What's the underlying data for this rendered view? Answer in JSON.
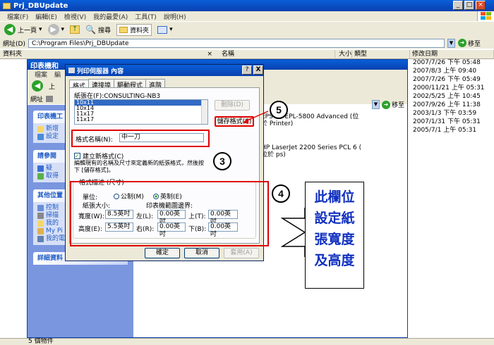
{
  "explorer": {
    "title": "Prj_DBUpdate",
    "menu": [
      "檔案(F)",
      "編輯(E)",
      "檢視(V)",
      "我的最愛(A)",
      "工具(T)",
      "說明(H)"
    ],
    "back_label": "上一頁",
    "search_label": "搜尋",
    "folders_label": "資料夾",
    "address_label": "網址(D)",
    "address_value": "C:\\Program Files\\Prj_DBUpdate",
    "go_label": "移至",
    "folder_pane_title": "資料夾",
    "close_glyph": "×",
    "columns": {
      "name": "名稱",
      "size": "大小",
      "type": "類型",
      "modified": "修改日期"
    },
    "dates": [
      "2007/7/26 下午 05:48",
      "2007/8/3 上午 09:40",
      "2007/7/26 下午 05:49",
      "2000/11/21 上午 05:31",
      "2002/5/25 上午 10:45",
      "2007/9/26 上午 11:38",
      "2003/1/3 下午 03:59",
      "2007/1/31 下午 05:31",
      "2005/7/1 上午 05:31"
    ],
    "status": "5 個物件"
  },
  "printers_window": {
    "title": "印表機和",
    "menu": [
      "檔案",
      "編"
    ],
    "back_label": "上",
    "address_label": "網址",
    "go_label": "移至",
    "printer1_lines": [
      "EPSON EPL-5800 Advanced (位",
      "於 Printer)"
    ],
    "printer2_lines": [
      "HP LaserJet 2200 Series PCL 6 (",
      "位於 ps)"
    ],
    "task_header": "印表機工",
    "task_items": [
      "新增",
      "設定"
    ],
    "see_also_header": "請參閱",
    "see_also_items": [
      "疑",
      "取得"
    ],
    "other_header": "其他位置",
    "other_items": [
      "控制",
      "掃描",
      "我的",
      "My Pi",
      "我的電腦"
    ],
    "details_header": "詳細資料",
    "chevron": "»"
  },
  "dialog": {
    "title": "列印伺服器 內容",
    "help_btn": "?",
    "close_btn": "X",
    "tabs": [
      "格式",
      "連接埠",
      "驅動程式",
      "進階"
    ],
    "paper_on_label": "紙張在(F):CONSULTING-NB3",
    "paper_list": [
      "10x11",
      "10x14",
      "11x17",
      "11x17"
    ],
    "delete_btn": "刪除(D)",
    "save_btn": "儲存格式(S)",
    "form_name_label": "格式名稱(N):",
    "form_name_value": "中一刀",
    "create_new_label": "建立新格式(C)",
    "description": "編輯現有的名稱及尺寸來定義新的紙張格式，然後按下 [儲存格式]。",
    "group_label": "格式描述 (尺寸)",
    "unit_label": "單位:",
    "unit_metric": "公制(M)",
    "unit_english": "英制(E)",
    "paper_size_label": "紙張大小:",
    "margin_label": "印表機範圍邊界:",
    "width_label": "寬度(W):",
    "width_value": "8.5英吋",
    "height_label": "高度(E):",
    "height_value": "5.5英吋",
    "left_label": "左(L):",
    "left_value": "0.00英吋",
    "right_label": "右(R):",
    "right_value": "0.00英吋",
    "top_label": "上(T):",
    "top_value": "0.00英吋",
    "bottom_label": "下(B):",
    "bottom_value": "0.00英吋",
    "ok_btn": "確定",
    "cancel_btn": "取消",
    "apply_btn": "套用(A)"
  },
  "annotations": {
    "step3": "3",
    "step4": "4",
    "step5": "5",
    "note_lines": [
      "此欄位",
      "設定紙",
      "張寬度",
      "及高度"
    ],
    "accent_red": "#e00000",
    "note_color": "#1030c0"
  }
}
